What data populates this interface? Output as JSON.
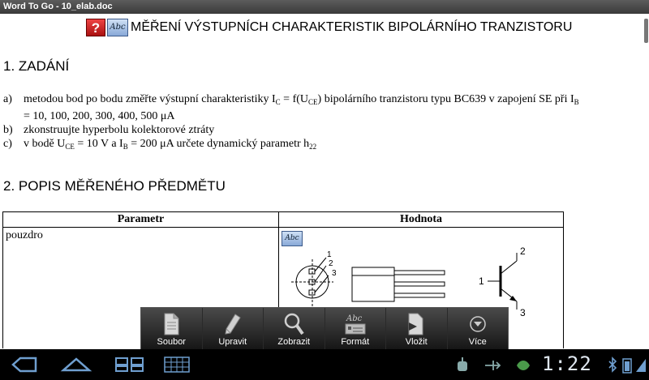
{
  "window": {
    "title": "Word To Go - 10_elab.doc"
  },
  "document": {
    "title": "MĚŘENÍ VÝSTUPNÍCH CHARAKTERISTIK BIPOLÁRNÍHO TRANZISTORU",
    "section1": "1. ZADÁNÍ",
    "items": {
      "a": {
        "marker": "a)",
        "t1": "metodou bod po bodu změřte výstupní charakteristiky I",
        "s1": "C",
        "t2": " = f(U",
        "s2": "CE",
        "t3": ") bipolárního tranzistoru typu BC639 v zapojení SE při I",
        "s3": "B",
        "cont": "= 10, 100, 200, 300, 400, 500 μA"
      },
      "b": {
        "marker": "b)",
        "text": "zkonstruujte hyperbolu kolektorové ztráty"
      },
      "c": {
        "marker": "c)",
        "t1": "v bodě U",
        "s1": "CE",
        "t2": " = 10 V a I",
        "s2": "B",
        "t3": " = 200 μA určete dynamický parametr h",
        "s3": "22"
      }
    },
    "section2": "2. POPIS MĚŘENÉHO PŘEDMĚTU",
    "table": {
      "headers": [
        "Parametr",
        "Hodnota"
      ],
      "row1_param": "pouzdro"
    },
    "diagram": {
      "pin_1": "1",
      "pin_2": "2",
      "pin_3": "3",
      "sym_1": "1",
      "sym_2": "2",
      "sym_3": "3"
    }
  },
  "toolbar": {
    "help": "?",
    "abc": "Abc"
  },
  "menu": {
    "items": [
      {
        "label": "Soubor",
        "icon": "document-icon"
      },
      {
        "label": "Upravit",
        "icon": "pencil-icon"
      },
      {
        "label": "Zobrazit",
        "icon": "magnifier-icon"
      },
      {
        "label": "Formát",
        "icon": "format-icon"
      },
      {
        "label": "Vložit",
        "icon": "insert-icon"
      },
      {
        "label": "Více",
        "icon": "more-icon"
      }
    ],
    "format_abc": "Abc"
  },
  "statusbar": {
    "time": "1:22"
  }
}
